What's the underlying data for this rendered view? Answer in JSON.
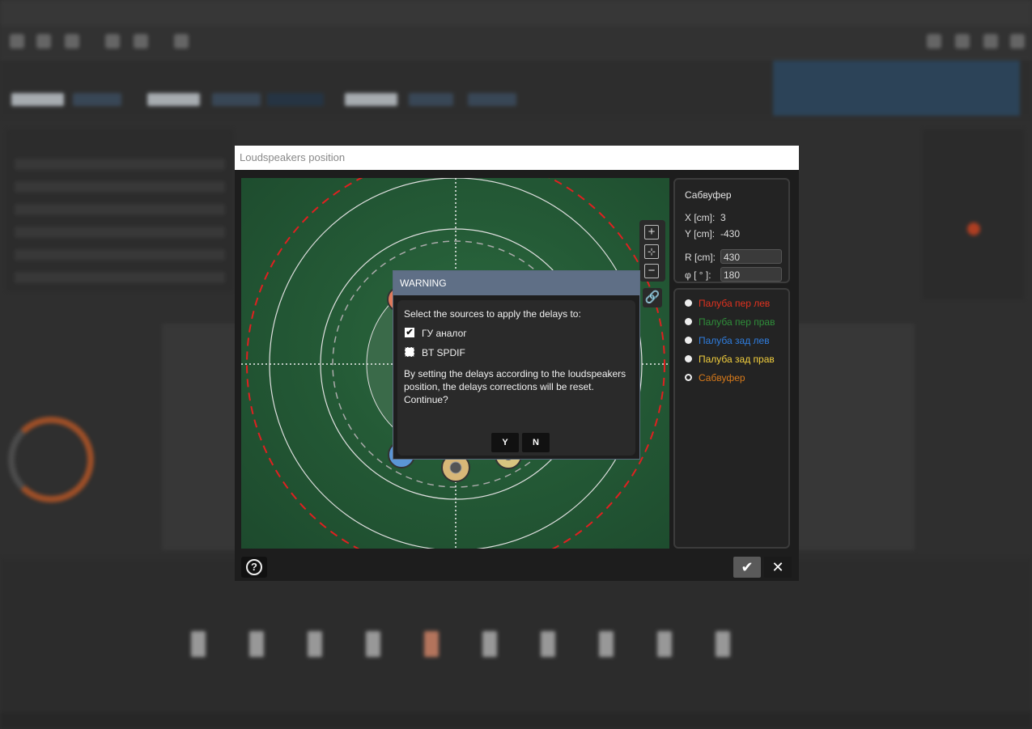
{
  "dialog": {
    "title": "Loudspeakers position",
    "ok_icon": "✔",
    "cancel_icon": "✕",
    "help_icon": "?"
  },
  "canvas": {
    "zoom_in": "+",
    "fit": "⊹",
    "zoom_out": "−",
    "link_icon": "🔗"
  },
  "info": {
    "title": "Сабвуфер",
    "x_label": "X [cm]:",
    "x_value": "3",
    "y_label": "Y [cm]:",
    "y_value": "-430",
    "r_label": "R [cm]:",
    "r_value": "430",
    "phi_label": "φ [ ° ]:",
    "phi_value": "180"
  },
  "speakers": [
    {
      "label": "Палуба пер лев",
      "color": "#e2321f",
      "selected": false
    },
    {
      "label": "Палуба пер прав",
      "color": "#2f8f3a",
      "selected": false
    },
    {
      "label": "Палуба зад лев",
      "color": "#2f7ee0",
      "selected": false
    },
    {
      "label": "Палуба зад прав",
      "color": "#f3cf3d",
      "selected": false
    },
    {
      "label": "Сабвуфер",
      "color": "#d87a1a",
      "selected": true
    }
  ],
  "warning": {
    "title": "WARNING",
    "prompt": "Select the sources to apply the delays to:",
    "sources": [
      {
        "label": "ГУ аналог",
        "checked": true
      },
      {
        "label": "BT SPDIF",
        "checked": false
      }
    ],
    "message_line1": "By setting the delays according to the loudspeakers",
    "message_line2": "position, the delays corrections will be reset.",
    "message_line3": "Continue?",
    "yes_label": "Y",
    "no_label": "N"
  }
}
